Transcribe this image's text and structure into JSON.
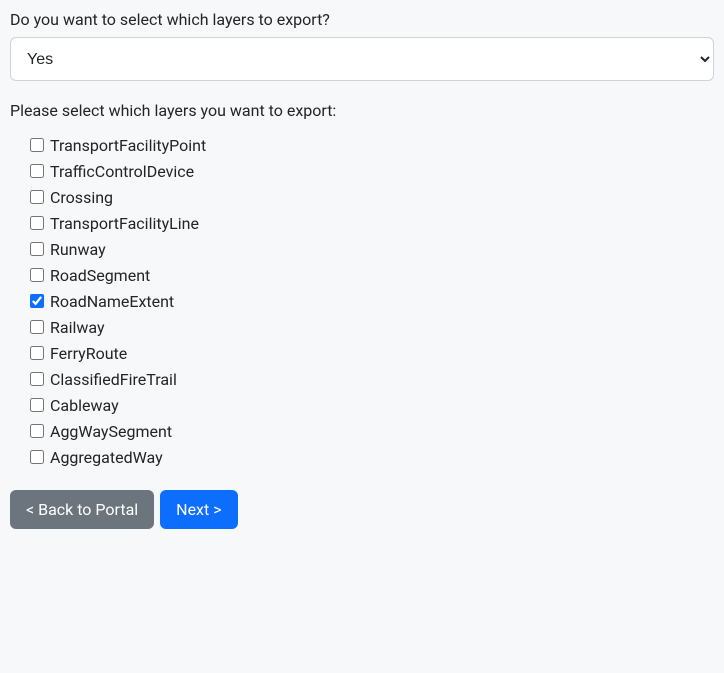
{
  "question1": "Do you want to select which layers to export?",
  "select": {
    "value": "Yes",
    "options": [
      "Yes"
    ]
  },
  "question2": "Please select which layers you want to export:",
  "layers": [
    {
      "name": "TransportFacilityPoint",
      "checked": false
    },
    {
      "name": "TrafficControlDevice",
      "checked": false
    },
    {
      "name": "Crossing",
      "checked": false
    },
    {
      "name": "TransportFacilityLine",
      "checked": false
    },
    {
      "name": "Runway",
      "checked": false
    },
    {
      "name": "RoadSegment",
      "checked": false
    },
    {
      "name": "RoadNameExtent",
      "checked": true
    },
    {
      "name": "Railway",
      "checked": false
    },
    {
      "name": "FerryRoute",
      "checked": false
    },
    {
      "name": "ClassifiedFireTrail",
      "checked": false
    },
    {
      "name": "Cableway",
      "checked": false
    },
    {
      "name": "AggWaySegment",
      "checked": false
    },
    {
      "name": "AggregatedWay",
      "checked": false
    }
  ],
  "buttons": {
    "back": "< Back to Portal",
    "next": "Next >"
  }
}
